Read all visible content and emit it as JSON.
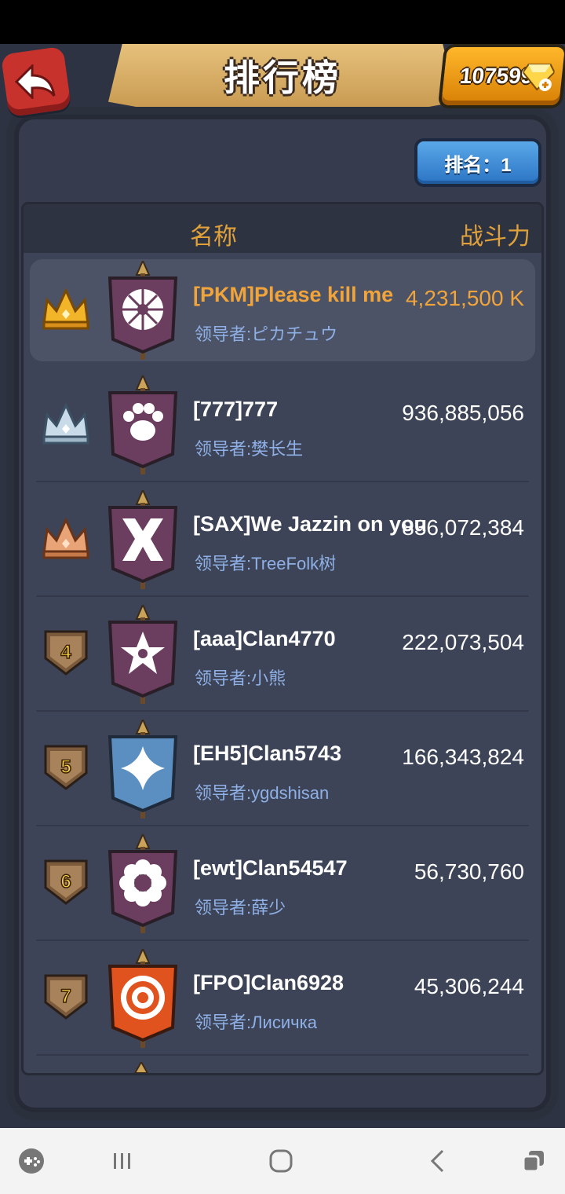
{
  "header": {
    "title": "排行榜",
    "gems": "107599"
  },
  "rank_button": {
    "label": "排名：1"
  },
  "columns": {
    "name": "名称",
    "power": "战斗力"
  },
  "rows": [
    {
      "rank": "1",
      "badge": "gold-crown",
      "emblem": "sunburst",
      "emblem_color": "#6b3d5e",
      "name": "[PKM]Please kill me",
      "leader": "领导者:ピカチュウ",
      "power": "4,231,500 K"
    },
    {
      "rank": "2",
      "badge": "silver-crown",
      "emblem": "paw",
      "emblem_color": "#6b3d5e",
      "name": "[777]777",
      "leader": "领导者:樊长生",
      "power": "936,885,056"
    },
    {
      "rank": "3",
      "badge": "bronze-crown",
      "emblem": "x-mark",
      "emblem_color": "#6b3d5e",
      "name": "[SAX]We Jazzin on you",
      "leader": "领导者:TreeFolk树",
      "power": "836,072,384"
    },
    {
      "rank": "4",
      "badge": "shield",
      "emblem": "star",
      "emblem_color": "#6b3d5e",
      "name": "[aaa]Clan4770",
      "leader": "领导者:小熊",
      "power": "222,073,504"
    },
    {
      "rank": "5",
      "badge": "shield",
      "emblem": "diamond",
      "emblem_color": "#5b8fc2",
      "name": "[EH5]Clan5743",
      "leader": "领导者:ygdshisan",
      "power": "166,343,824"
    },
    {
      "rank": "6",
      "badge": "shield",
      "emblem": "flower",
      "emblem_color": "#6b3d5e",
      "name": "[ewt]Clan54547",
      "leader": "领导者:薛少",
      "power": "56,730,760"
    },
    {
      "rank": "7",
      "badge": "shield",
      "emblem": "target",
      "emblem_color": "#e0521e",
      "name": "[FPO]Clan6928",
      "leader": "领导者:Лисичка",
      "power": "45,306,244"
    }
  ],
  "colors": {
    "accent": "#e0a13a",
    "leader_text": "#8fb0e6",
    "panel": "#3d4457"
  }
}
